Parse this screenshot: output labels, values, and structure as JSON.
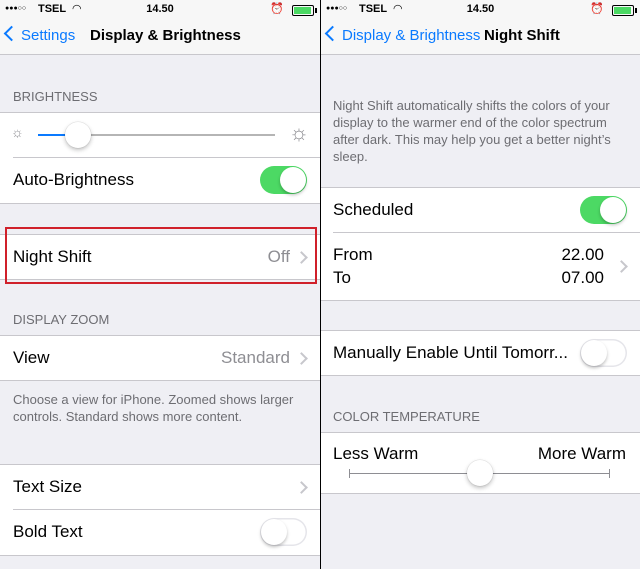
{
  "left": {
    "status": {
      "carrier": "TSEL",
      "time": "14.50"
    },
    "nav": {
      "back_label": "Settings",
      "title": "Display & Brightness"
    },
    "brightness": {
      "header": "BRIGHTNESS",
      "level": 0.17
    },
    "auto_brightness": {
      "label": "Auto-Brightness",
      "on": true
    },
    "night_shift": {
      "label": "Night Shift",
      "value": "Off"
    },
    "display_zoom": {
      "header": "DISPLAY ZOOM",
      "view_label": "View",
      "view_value": "Standard",
      "note": "Choose a view for iPhone. Zoomed shows larger controls. Standard shows more content."
    },
    "text_size": {
      "label": "Text Size"
    },
    "bold_text": {
      "label": "Bold Text",
      "on": false
    }
  },
  "right": {
    "status": {
      "carrier": "TSEL",
      "time": "14.50"
    },
    "nav": {
      "back_label": "Display & Brightness",
      "title": "Night Shift"
    },
    "description": "Night Shift automatically shifts the colors of your display to the warmer end of the color spectrum after dark. This may help you get a better night’s sleep.",
    "scheduled": {
      "label": "Scheduled",
      "on": true
    },
    "from": {
      "label": "From",
      "value": "22.00"
    },
    "to": {
      "label": "To",
      "value": "07.00"
    },
    "manual": {
      "label": "Manually Enable Until Tomorr...",
      "on": false
    },
    "color_temp": {
      "header": "COLOR TEMPERATURE",
      "less": "Less Warm",
      "more": "More Warm",
      "level": 0.5
    }
  },
  "colors": {
    "accent": "#0a7aff",
    "toggle_on": "#4cd964",
    "highlight": "#d0202a"
  }
}
